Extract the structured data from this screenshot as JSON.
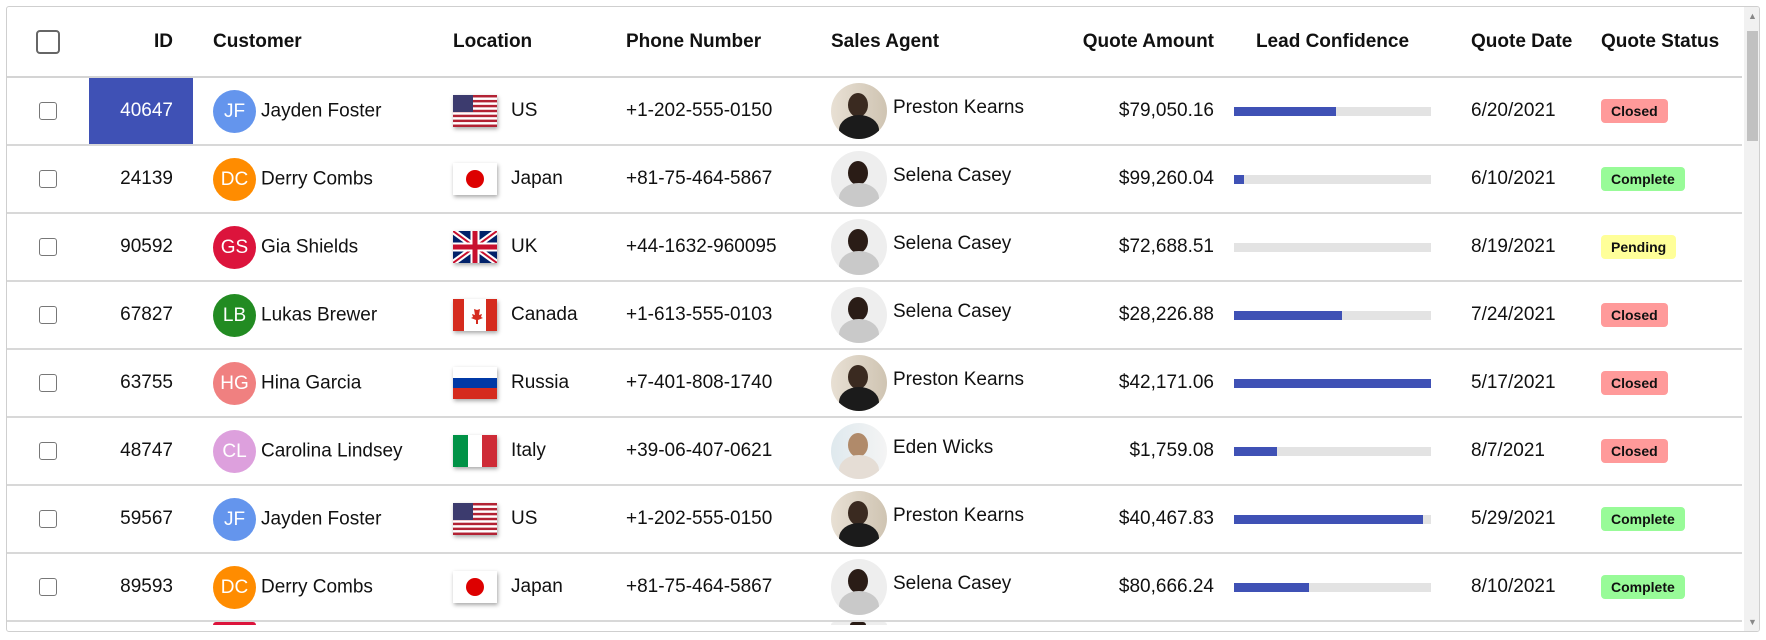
{
  "columns": {
    "id": "ID",
    "customer": "Customer",
    "location": "Location",
    "phone": "Phone Number",
    "agent": "Sales Agent",
    "amount": "Quote Amount",
    "confidence": "Lead Confidence",
    "date": "Quote Date",
    "status": "Quote Status"
  },
  "colors": {
    "accent": "#3f51b5",
    "closed": "#ff9a9a",
    "complete": "#98fb98",
    "pending": "#ffff99"
  },
  "rows": [
    {
      "id": "40647",
      "initials": "JF",
      "customer": "Jayden Foster",
      "avatar_color": "#6495ed",
      "flag": "us",
      "location": "US",
      "phone": "+1-202-555-0150",
      "agent": "Preston Kearns",
      "agent_photo": "man",
      "amount": "$79,050.16",
      "confidence": 52,
      "date": "6/20/2021",
      "status": "Closed",
      "selected": true
    },
    {
      "id": "24139",
      "initials": "DC",
      "customer": "Derry Combs",
      "avatar_color": "#ff8c00",
      "flag": "japan",
      "location": "Japan",
      "phone": "+81-75-464-5867",
      "agent": "Selena Casey",
      "agent_photo": "woman",
      "amount": "$99,260.04",
      "confidence": 5,
      "date": "6/10/2021",
      "status": "Complete"
    },
    {
      "id": "90592",
      "initials": "GS",
      "customer": "Gia Shields",
      "avatar_color": "#dc143c",
      "flag": "uk",
      "location": "UK",
      "phone": "+44-1632-960095",
      "agent": "Selena Casey",
      "agent_photo": "woman",
      "amount": "$72,688.51",
      "confidence": 0,
      "date": "8/19/2021",
      "status": "Pending"
    },
    {
      "id": "67827",
      "initials": "LB",
      "customer": "Lukas Brewer",
      "avatar_color": "#228b22",
      "flag": "canada",
      "location": "Canada",
      "phone": "+1-613-555-0103",
      "agent": "Selena Casey",
      "agent_photo": "woman",
      "amount": "$28,226.88",
      "confidence": 55,
      "date": "7/24/2021",
      "status": "Closed"
    },
    {
      "id": "63755",
      "initials": "HG",
      "customer": "Hina Garcia",
      "avatar_color": "#f08080",
      "flag": "russia",
      "location": "Russia",
      "phone": "+7-401-808-1740",
      "agent": "Preston Kearns",
      "agent_photo": "man",
      "amount": "$42,171.06",
      "confidence": 100,
      "date": "5/17/2021",
      "status": "Closed"
    },
    {
      "id": "48747",
      "initials": "CL",
      "customer": "Carolina Lindsey",
      "avatar_color": "#dda0dd",
      "flag": "italy",
      "location": "Italy",
      "phone": "+39-06-407-0621",
      "agent": "Eden Wicks",
      "agent_photo": "woman2",
      "amount": "$1,759.08",
      "confidence": 22,
      "date": "8/7/2021",
      "status": "Closed"
    },
    {
      "id": "59567",
      "initials": "JF",
      "customer": "Jayden Foster",
      "avatar_color": "#6495ed",
      "flag": "us",
      "location": "US",
      "phone": "+1-202-555-0150",
      "agent": "Preston Kearns",
      "agent_photo": "man",
      "amount": "$40,467.83",
      "confidence": 96,
      "date": "5/29/2021",
      "status": "Complete"
    },
    {
      "id": "89593",
      "initials": "DC",
      "customer": "Derry Combs",
      "avatar_color": "#ff8c00",
      "flag": "japan",
      "location": "Japan",
      "phone": "+81-75-464-5867",
      "agent": "Selena Casey",
      "agent_photo": "woman",
      "amount": "$80,666.24",
      "confidence": 38,
      "date": "8/10/2021",
      "status": "Complete"
    }
  ]
}
